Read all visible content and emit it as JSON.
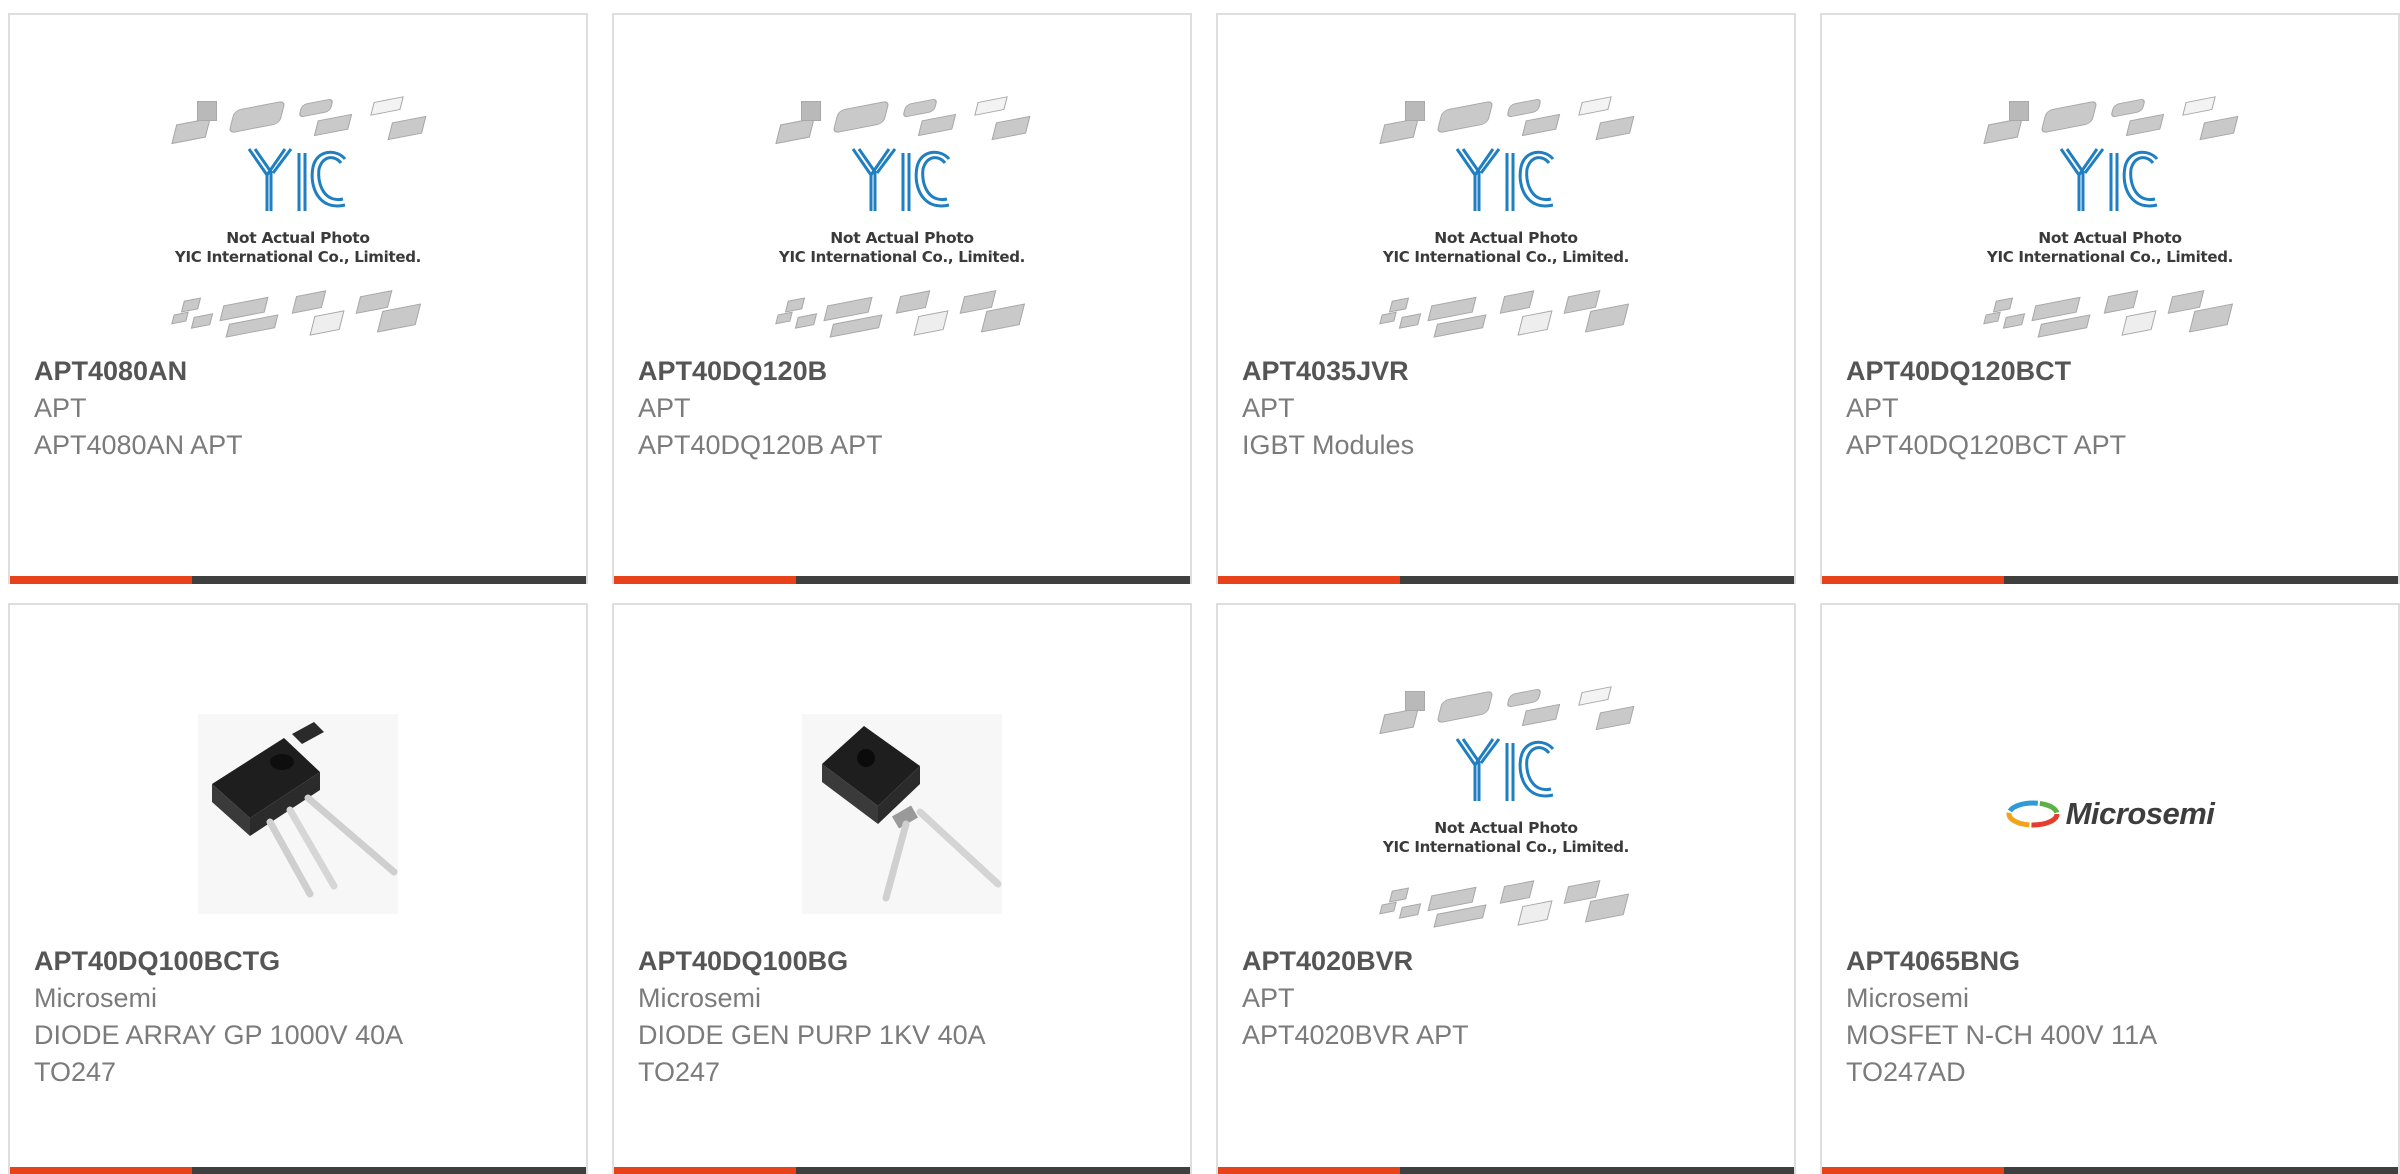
{
  "products": [
    {
      "part": "APT4080AN",
      "manufacturer": "APT",
      "description_lines": [
        "APT4080AN APT"
      ],
      "image": "placeholder",
      "placeholder_caption": [
        "Not Actual Photo",
        "YIC International Co., Limited."
      ]
    },
    {
      "part": "APT40DQ120B",
      "manufacturer": "APT",
      "description_lines": [
        "APT40DQ120B APT"
      ],
      "image": "placeholder",
      "placeholder_caption": [
        "Not Actual Photo",
        "YIC International Co., Limited."
      ]
    },
    {
      "part": "APT4035JVR",
      "manufacturer": "APT",
      "description_lines": [
        "IGBT Modules"
      ],
      "image": "placeholder",
      "placeholder_caption": [
        "Not Actual Photo",
        "YIC International Co., Limited."
      ]
    },
    {
      "part": "APT40DQ120BCT",
      "manufacturer": "APT",
      "description_lines": [
        "APT40DQ120BCT APT"
      ],
      "image": "placeholder",
      "placeholder_caption": [
        "Not Actual Photo",
        "YIC International Co., Limited."
      ]
    },
    {
      "part": "APT40DQ100BCTG",
      "manufacturer": "Microsemi",
      "description_lines": [
        "DIODE ARRAY GP 1000V 40A",
        "TO247"
      ],
      "image": "to247-3lead"
    },
    {
      "part": "APT40DQ100BG",
      "manufacturer": "Microsemi",
      "description_lines": [
        "DIODE GEN PURP 1KV 40A",
        "TO247"
      ],
      "image": "to247-2lead"
    },
    {
      "part": "APT4020BVR",
      "manufacturer": "APT",
      "description_lines": [
        "APT4020BVR APT"
      ],
      "image": "placeholder",
      "placeholder_caption": [
        "Not Actual Photo",
        "YIC International Co., Limited."
      ]
    },
    {
      "part": "APT4065BNG",
      "manufacturer": "Microsemi",
      "description_lines": [
        "MOSFET N-CH 400V 11A",
        "TO247AD"
      ],
      "image": "microsemi-logo",
      "logo_text": "Microsemi"
    }
  ],
  "colors": {
    "accent": "#e8421b",
    "bar": "#3f3f3f",
    "title": "#555555",
    "text": "#7b7b7b",
    "border": "#dedede",
    "yic_blue": "#1f7fc1"
  }
}
